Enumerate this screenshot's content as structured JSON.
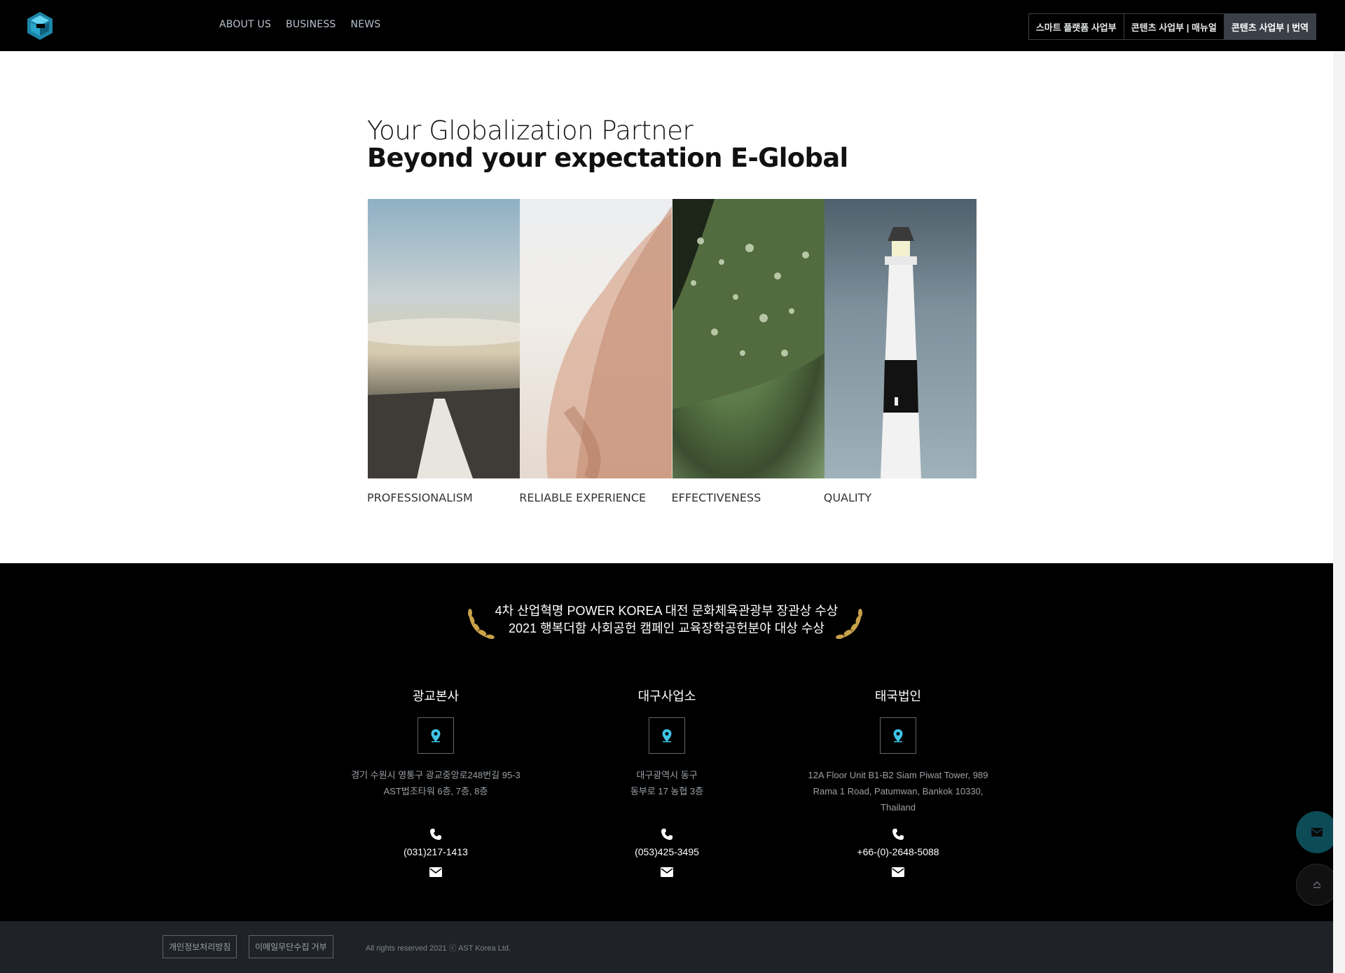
{
  "header": {
    "nav": [
      "ABOUT US",
      "BUSINESS",
      "NEWS"
    ],
    "top_buttons": [
      "스마트 플랫폼 사업부",
      "콘텐츠 사업부 | 매뉴얼",
      "콘텐츠 사업부 | 번역"
    ]
  },
  "intro": {
    "line1": "Your Globalization Partner",
    "line2": "Beyond your expectation E-Global"
  },
  "values": [
    "PROFESSIONALISM",
    "RELIABLE EXPERIENCE",
    "EFFECTIVENESS",
    "QUALITY"
  ],
  "award": {
    "line1": "4차 산업혁명 POWER KOREA 대전 문화체육관광부 장관상 수상",
    "line2": "2021 행복더함 사회공헌 캠페인 교육장학공헌분야 대상 수상"
  },
  "offices": [
    {
      "name": "광교본사",
      "addr1": "경기 수원시 영통구 광교중앙로248번길 95-3",
      "addr2": "AST법조타워 6층, 7층, 8층",
      "addr3": "",
      "tel": "(031)217-1413"
    },
    {
      "name": "대구사업소",
      "addr1": "대구광역시 동구",
      "addr2": "동부로 17 농협 3층",
      "addr3": "",
      "tel": "(053)425-3495"
    },
    {
      "name": "태국법인",
      "addr1": "12A Floor Unit B1-B2 Siam Piwat Tower, 989",
      "addr2": "Rama 1 Road, Patumwan, Bankok 10330,",
      "addr3": "Thailand",
      "tel": "+66-(0)-2648-5088"
    }
  ],
  "footer": {
    "privacy": "개인정보처리방침",
    "email_refuse": "이메일무단수집 거부",
    "copyright": "All rights reserved 2021 ⓒ AST Korea Ltd."
  },
  "colors": {
    "accent": "#3fc3e6",
    "fab": "#0d4b57"
  }
}
